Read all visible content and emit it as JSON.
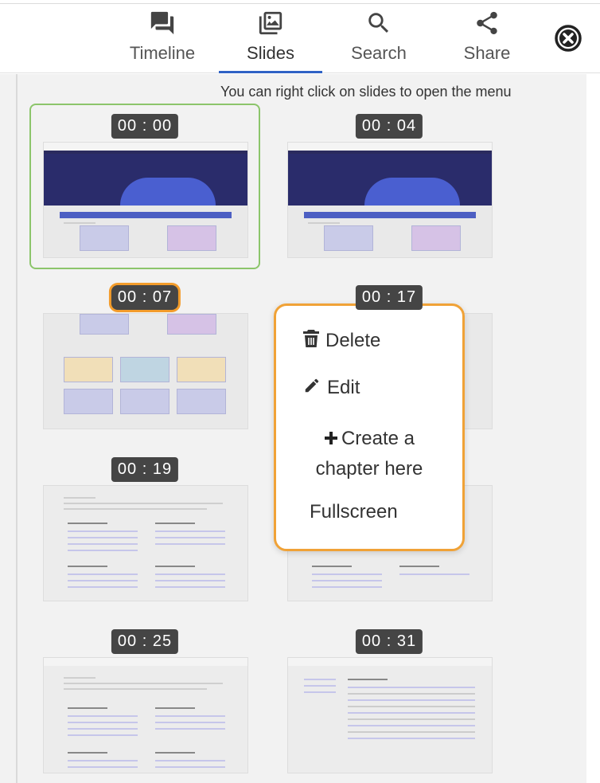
{
  "tabs": [
    {
      "label": "Timeline",
      "icon": "chat-icon",
      "active": false
    },
    {
      "label": "Slides",
      "icon": "slides-icon",
      "active": true
    },
    {
      "label": "Search",
      "icon": "search-icon",
      "active": false
    },
    {
      "label": "Share",
      "icon": "share-icon",
      "active": false
    }
  ],
  "close_icon": "close-circle-icon",
  "hint": "You can right click on slides to open the menu",
  "slides": [
    {
      "time": "00 : 00",
      "selected": true,
      "thumb": "home"
    },
    {
      "time": "00 : 04",
      "selected": false,
      "thumb": "home"
    },
    {
      "time": "00 : 07",
      "selected": false,
      "thumb": "grid"
    },
    {
      "time": "00 : 17",
      "selected": false,
      "thumb": "grid"
    },
    {
      "time": "00 : 19",
      "selected": false,
      "thumb": "doc"
    },
    {
      "time": "00 : 25",
      "selected": false,
      "thumb": "doc"
    },
    {
      "time": "00 : 31",
      "selected": false,
      "thumb": "list"
    }
  ],
  "menu": {
    "delete": "Delete",
    "edit": "Edit",
    "create_chapter": "Create a chapter here",
    "fullscreen": "Fullscreen"
  },
  "colors": {
    "accent": "#2f62c5",
    "selected_outline": "#8cc56b",
    "menu_border": "#f0a237",
    "time_badge": "#454545"
  }
}
